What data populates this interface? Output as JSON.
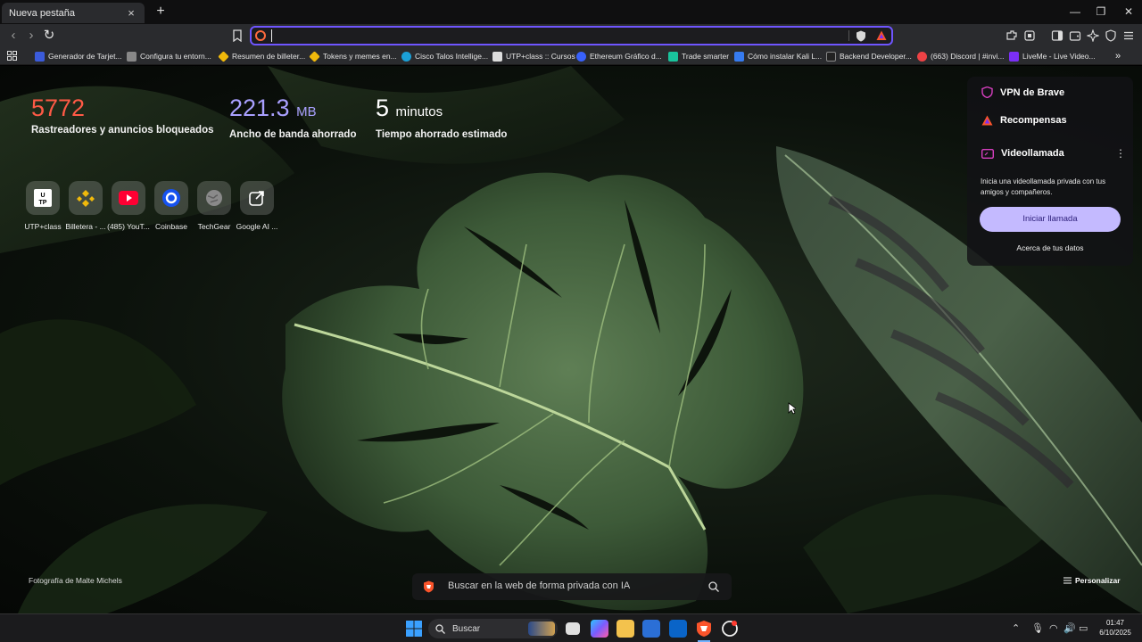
{
  "tab": {
    "title": "Nueva pestaña",
    "close": "×",
    "new": "+"
  },
  "window": {
    "minimize": "—",
    "maximize": "❐",
    "close": "✕"
  },
  "toolbar": {
    "back": "‹",
    "forward": "›",
    "reload": "↻",
    "url_value": "",
    "url_placeholder": ""
  },
  "bookmarks": [
    {
      "label": "Generador de Tarjet...",
      "color": "#3b5bdb"
    },
    {
      "label": "Configura tu entorn...",
      "color": "#888888"
    },
    {
      "label": "Resumen de billeter...",
      "color": "#f0b90b"
    },
    {
      "label": "Tokens y memes en...",
      "color": "#f0b90b"
    },
    {
      "label": "Cisco Talos Intellige...",
      "color": "#1ba0d7"
    },
    {
      "label": "UTP+class :: Cursos",
      "color": "#dddddd"
    },
    {
      "label": "Ethereum Gráfico d...",
      "color": "#3861fb"
    },
    {
      "label": "Trade smarter",
      "color": "#19c39c"
    },
    {
      "label": "Cómo instalar Kali L...",
      "color": "#367bf0"
    },
    {
      "label": "Backend Developer...",
      "color": "#222222"
    },
    {
      "label": "(663) Discord | #invi...",
      "color": "#ed4245"
    },
    {
      "label": "LiveMe - Live Video...",
      "color": "#7b2ff7"
    }
  ],
  "stats": [
    {
      "value": "5772",
      "unit": "",
      "label": "Rastreadores y anuncios bloqueados",
      "color": "#ff5a46"
    },
    {
      "value": "221.3",
      "unit": "MB",
      "label": "Ancho de banda ahorrado",
      "color": "#a9a0ff"
    },
    {
      "value": "5",
      "unit": "minutos",
      "label": "Tiempo ahorrado estimado",
      "color": "#ffffff"
    }
  ],
  "shortcuts": [
    {
      "label": "UTP+class",
      "icon": "utp-icon"
    },
    {
      "label": "Billetera - ...",
      "icon": "binance-icon"
    },
    {
      "label": "(485) YouT...",
      "icon": "youtube-icon"
    },
    {
      "label": "Coinbase",
      "icon": "coinbase-icon"
    },
    {
      "label": "TechGear",
      "icon": "globe-icon"
    },
    {
      "label": "Google AI ...",
      "icon": "external-icon"
    }
  ],
  "panel": {
    "vpn": "VPN de Brave",
    "rewards": "Recompensas",
    "video": "Videollamada",
    "more": "⋮",
    "description": "Inicia una videollamada privada con tus amigos y compañeros.",
    "call_button": "Iniciar llamada",
    "data_link": "Acerca de tus datos"
  },
  "bottom": {
    "credit": "Fotografía de Malte Michels",
    "customize": "Personalizar",
    "ai_search_placeholder": "Buscar en la web de forma privada con IA"
  },
  "taskbar": {
    "search": "Buscar",
    "time": "01:47",
    "date": "6/10/2025"
  },
  "colors": {
    "accent": "#6f55ff",
    "brave": "#fb542b",
    "call_button": "#c4baff"
  }
}
